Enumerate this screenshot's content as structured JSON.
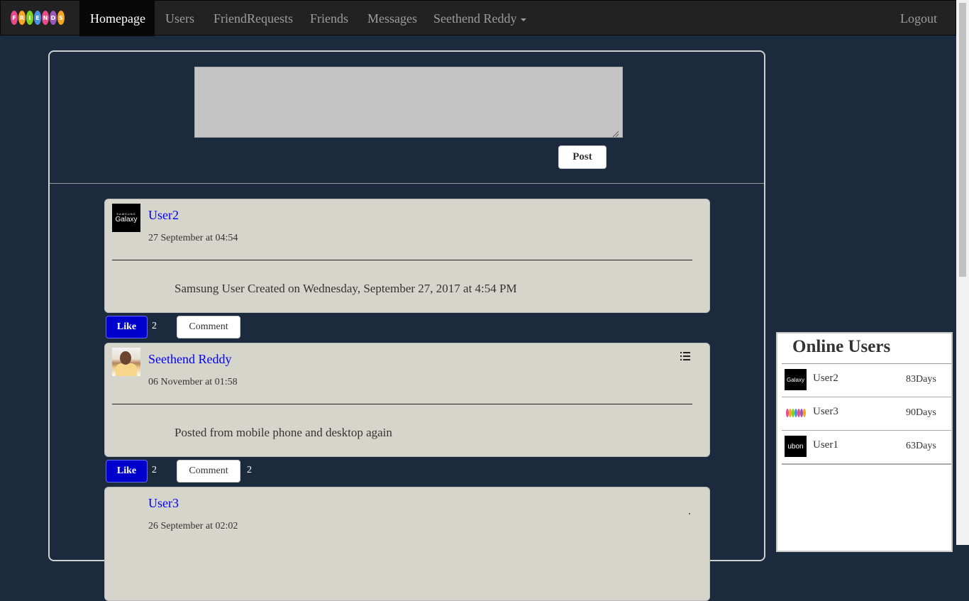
{
  "nav": {
    "brand_letters": [
      "F",
      "R",
      "I",
      "E",
      "N",
      "D",
      "S"
    ],
    "brand_colors": [
      "#e84a8a",
      "#f5a623",
      "#7ed321",
      "#4a90e2",
      "#e84a8a",
      "#9b59b6",
      "#f5a623"
    ],
    "items": [
      {
        "label": "Homepage",
        "active": true
      },
      {
        "label": "Users",
        "active": false
      },
      {
        "label": "FriendRequests",
        "active": false
      },
      {
        "label": "Friends",
        "active": false
      },
      {
        "label": "Messages",
        "active": false
      },
      {
        "label": "Seethend Reddy",
        "active": false
      }
    ],
    "logout": "Logout"
  },
  "composer": {
    "value": "",
    "post_button": "Post"
  },
  "posts": [
    {
      "author": "User2",
      "avatar": "samsung-galaxy-avatar",
      "avatar_small_text": "SAMSUNG",
      "avatar_big_text": "Galaxy",
      "time": "27 September at 04:54",
      "text": "Samsung User Created on Wednesday, September 27, 2017 at 4:54 PM",
      "like_label": "Like",
      "likes": "2",
      "comment_label": "Comment",
      "comments": ""
    },
    {
      "author": "Seethend Reddy",
      "avatar": "user-photo-avatar",
      "time": "06 November at 01:58",
      "text": "Posted from mobile phone and desktop again",
      "like_label": "Like",
      "likes": "2",
      "comment_label": "Comment",
      "comments": "2"
    },
    {
      "author": "User3",
      "avatar": "none",
      "time": "26 September at 02:02",
      "text": ""
    }
  ],
  "online_users": {
    "title": "Online Users",
    "users": [
      {
        "name": "User2",
        "days": "83Days",
        "avatar": "galaxy",
        "avatar_text": "Galaxy"
      },
      {
        "name": "User3",
        "days": "90Days",
        "avatar": "friends"
      },
      {
        "name": "User1",
        "days": "63Days",
        "avatar": "ubon",
        "avatar_text": "ubon"
      }
    ]
  },
  "colors": {
    "background": "#1b2a3d",
    "navbar": "#222222",
    "link": "#0000ee",
    "like": "#0000cd",
    "card": "#d6d5cc"
  }
}
